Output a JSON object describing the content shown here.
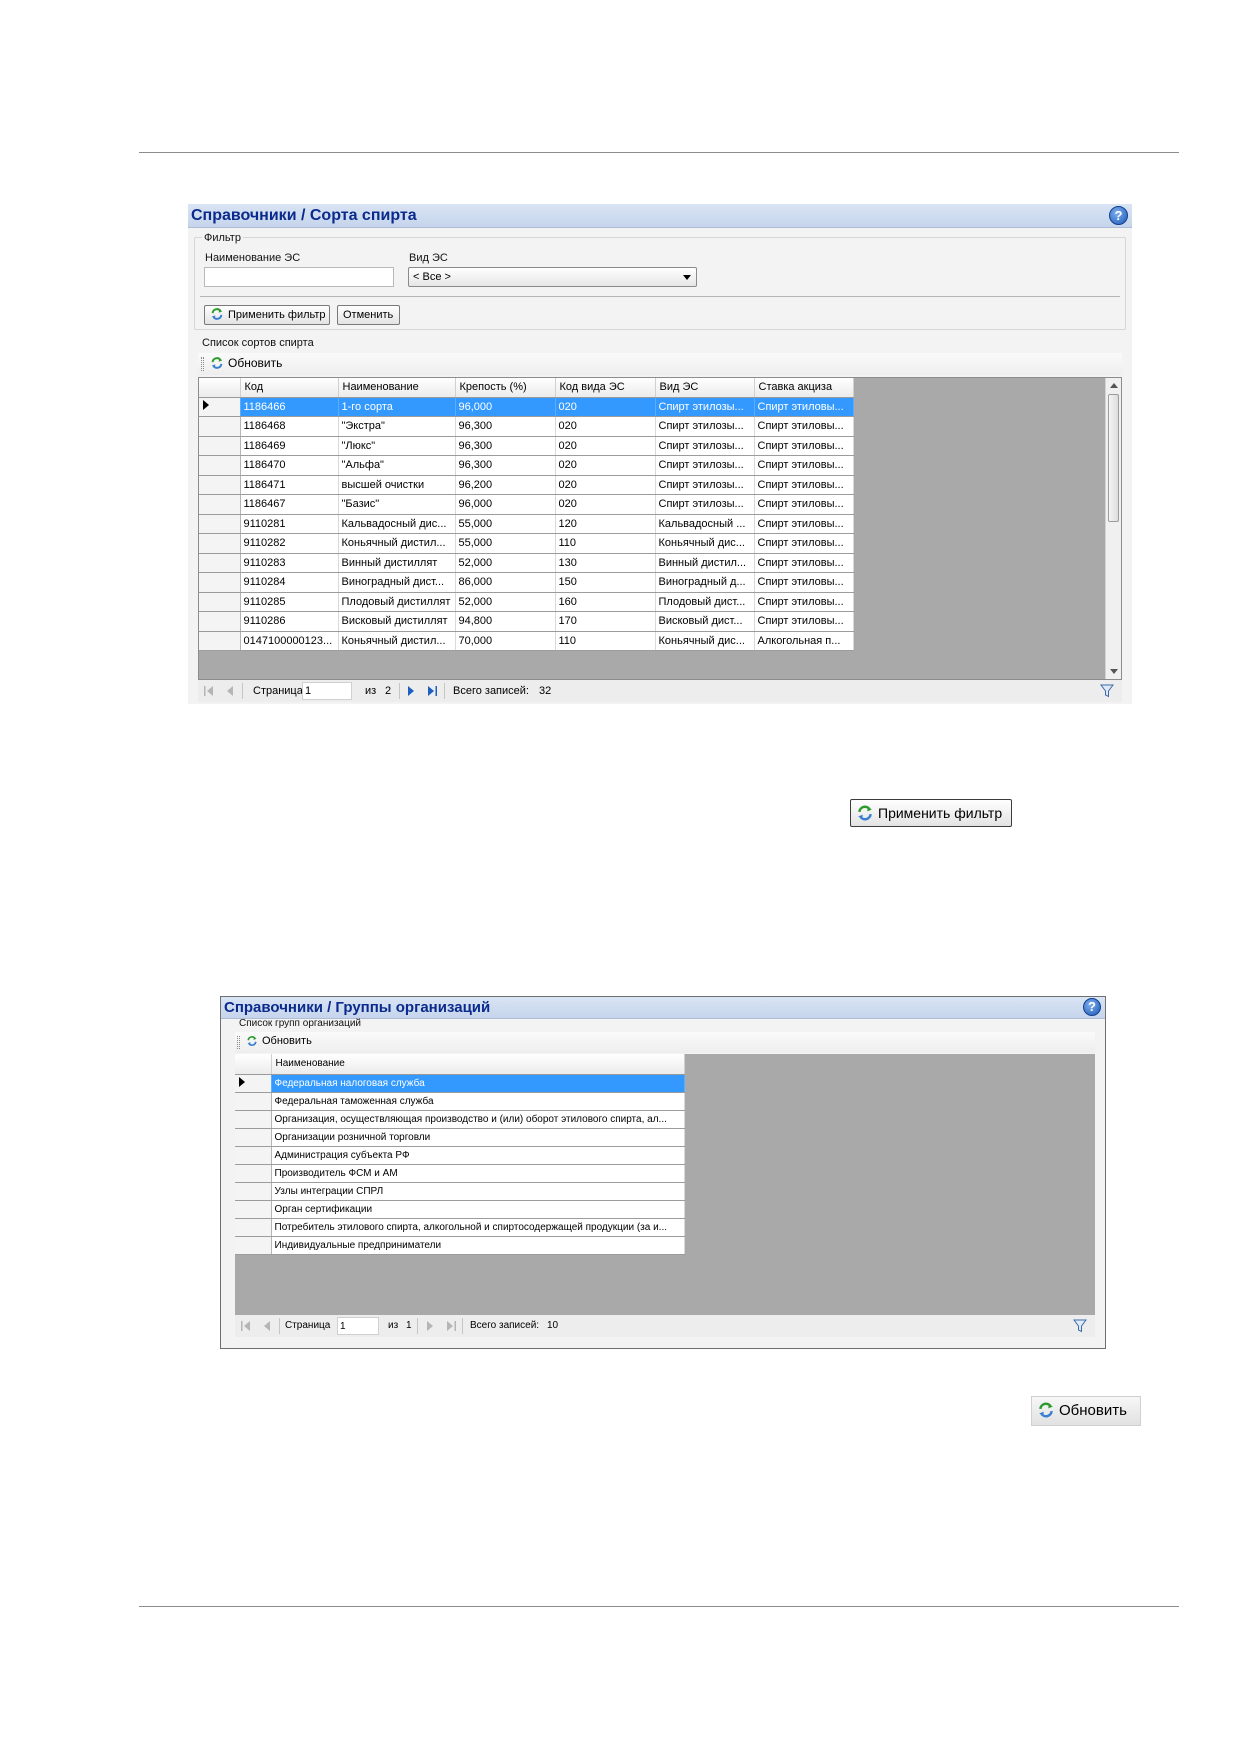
{
  "w1": {
    "title": "Справочники / Сорта спирта",
    "filter": {
      "legend": "Фильтр",
      "name_label": "Наименование ЭС",
      "name_value": "",
      "type_label": "Вид ЭС",
      "type_value": "< Все >",
      "apply_label": "Применить фильтр",
      "cancel_label": "Отменить"
    },
    "list_label": "Список сортов спирта",
    "refresh_label": "Обновить",
    "columns": [
      "Код",
      "Наименование",
      "Крепость (%)",
      "Код вида ЭС",
      "Вид ЭС",
      "Ставка акциза"
    ],
    "rows": [
      [
        "1186466",
        "1-го сорта",
        "96,000",
        "020",
        "Спирт этилозы...",
        "Спирт этиловы..."
      ],
      [
        "1186468",
        "\"Экстра\"",
        "96,300",
        "020",
        "Спирт этилозы...",
        "Спирт этиловы..."
      ],
      [
        "1186469",
        "\"Люкс\"",
        "96,300",
        "020",
        "Спирт этилозы...",
        "Спирт этиловы..."
      ],
      [
        "1186470",
        "\"Альфа\"",
        "96,300",
        "020",
        "Спирт этилозы...",
        "Спирт этиловы..."
      ],
      [
        "1186471",
        "высшей очистки",
        "96,200",
        "020",
        "Спирт этилозы...",
        "Спирт этиловы..."
      ],
      [
        "1186467",
        "\"Базис\"",
        "96,000",
        "020",
        "Спирт этилозы...",
        "Спирт этиловы..."
      ],
      [
        "9110281",
        "Кальвадосный дис...",
        "55,000",
        "120",
        "Кальвадосный ...",
        "Спирт этиловы..."
      ],
      [
        "9110282",
        "Коньячный дистил...",
        "55,000",
        "110",
        "Коньячный дис...",
        "Спирт этиловы..."
      ],
      [
        "9110283",
        "Винный дистиллят",
        "52,000",
        "130",
        "Винный дистил...",
        "Спирт этиловы..."
      ],
      [
        "9110284",
        "Виноградный дист...",
        "86,000",
        "150",
        "Виноградный д...",
        "Спирт этиловы..."
      ],
      [
        "9110285",
        "Плодовый дистиллят",
        "52,000",
        "160",
        "Плодовый дист...",
        "Спирт этиловы..."
      ],
      [
        "9110286",
        "Висковый дистиллят",
        "94,800",
        "170",
        "Висковый дист...",
        "Спирт этиловы..."
      ],
      [
        "0147100000123...",
        "Коньячный дистил...",
        "70,000",
        "110",
        "Коньячный дис...",
        "Алкогольная п..."
      ]
    ],
    "pager": {
      "page_label": "Страница",
      "page": "1",
      "of_label": "из",
      "pages": "2",
      "total_label": "Всего записей:",
      "total": "32"
    }
  },
  "standalone_apply_label": "Применить фильтр",
  "w2": {
    "title": "Справочники / Группы организаций",
    "list_label": "Список групп организаций",
    "refresh_label": "Обновить",
    "column": "Наименование",
    "rows": [
      "Федеральная налоговая служба",
      "Федеральная таможенная служба",
      "Организация, осуществляющая производство и (или) оборот этилового спирта, ал...",
      "Организации розничной торговли",
      "Администрация субъекта РФ",
      "Производитель ФСМ и АМ",
      "Узлы интеграции СПРЛ",
      "Орган сертификации",
      "Потребитель этилового спирта, алкогольной и спиртосодержащей продукции (за и...",
      "Индивидуальные предприниматели"
    ],
    "pager": {
      "page_label": "Страница",
      "page": "1",
      "of_label": "из",
      "pages": "1",
      "total_label": "Всего записей:",
      "total": "10"
    }
  },
  "standalone_refresh_label": "Обновить",
  "icons": {
    "help": "help-icon",
    "refresh": "refresh-icon",
    "filter": "funnel-icon"
  },
  "colors": {
    "title_text": "#0a2a8c",
    "selection": "#3399ff",
    "grid_empty": "#a9a9a9"
  }
}
